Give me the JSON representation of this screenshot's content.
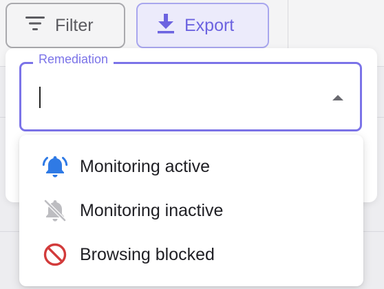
{
  "toolbar": {
    "filter_label": "Filter",
    "export_label": "Export"
  },
  "remediation": {
    "legend": "Remediation",
    "value": "",
    "options": [
      {
        "label": "Monitoring active",
        "icon": "bell-active-icon",
        "color": "#2f7ae5"
      },
      {
        "label": "Monitoring inactive",
        "icon": "bell-off-icon",
        "color": "#b8b8bc"
      },
      {
        "label": "Browsing blocked",
        "icon": "blocked-icon",
        "color": "#d23b3b"
      }
    ]
  },
  "colors": {
    "accent": "#7b73e8",
    "export": "#6c63e0"
  }
}
